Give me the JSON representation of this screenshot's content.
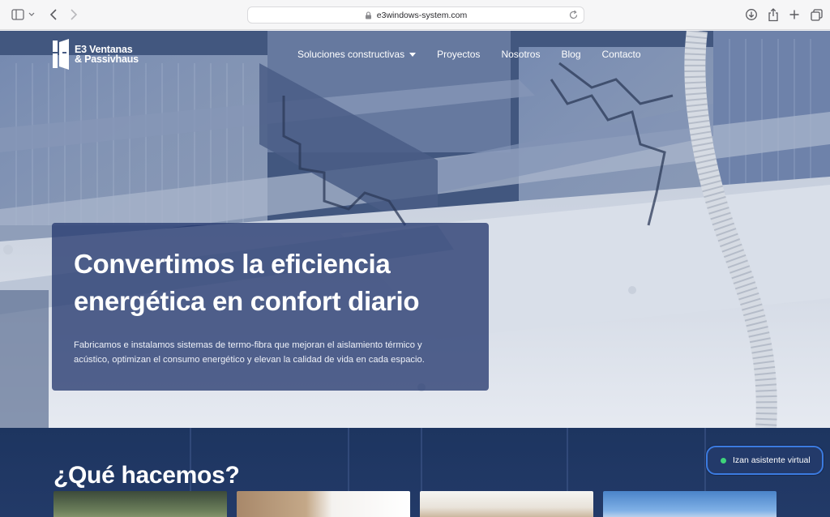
{
  "browser": {
    "url": "e3windows-system.com",
    "icons": {
      "sidebar": "sidebar-icon",
      "back": "chevron-left-icon",
      "forward": "chevron-right-icon",
      "lock": "lock-icon",
      "reload": "reload-icon",
      "download": "download-icon",
      "share": "share-icon",
      "new_tab": "plus-icon",
      "tabs": "tabs-overview-icon"
    }
  },
  "brand": {
    "line1": "E3 Ventanas",
    "line2": "& Passivhaus"
  },
  "nav": {
    "items": [
      {
        "label": "Soluciones constructivas"
      },
      {
        "label": "Proyectos"
      },
      {
        "label": "Nosotros"
      },
      {
        "label": "Blog"
      },
      {
        "label": "Contacto"
      }
    ]
  },
  "hero": {
    "title_line1": "Convertimos la eficiencia",
    "title_line2": "energética en confort diario",
    "subtitle": "Fabricamos e instalamos sistemas de termo-fibra que mejoran el aislamiento térmico y acústico, optimizan el consumo energético y elevan la calidad de vida en cada espacio."
  },
  "section": {
    "title": "¿Qué hacemos?"
  },
  "assistant": {
    "label": "Izan asistente virtual",
    "status_color": "#3ed47a"
  },
  "colors": {
    "accent": "#3b7be0",
    "hero_card": "#263a70",
    "section_bg": "#1d3560"
  }
}
